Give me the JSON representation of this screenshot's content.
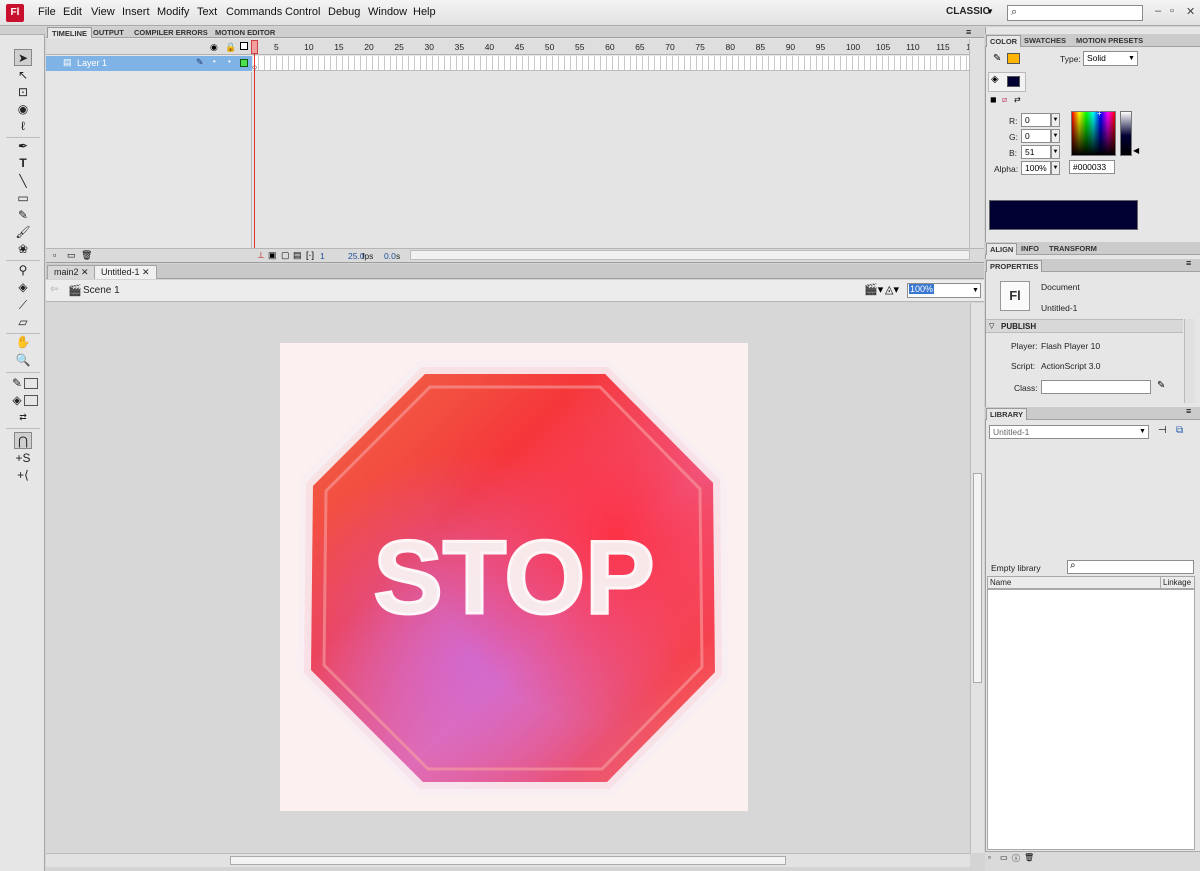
{
  "app": {
    "logo": "Fl",
    "menu": [
      "File",
      "Edit",
      "View",
      "Insert",
      "Modify",
      "Text",
      "Commands",
      "Control",
      "Debug",
      "Window",
      "Help"
    ],
    "workspace": "CLASSIC",
    "search_placeholder": "",
    "window_buttons": [
      "minimize-icon",
      "restore-icon",
      "close-icon"
    ]
  },
  "tools": [
    "selection",
    "subselection",
    "free-transform",
    "3d-rotation",
    "lasso",
    "pen",
    "text",
    "line",
    "rectangle",
    "pencil",
    "brush",
    "deco",
    "bone",
    "paint-bucket",
    "eyedropper",
    "eraser",
    "hand",
    "zoom",
    "stroke-color",
    "fill-color",
    "swap-colors",
    "snap-to-objects",
    "smooth",
    "straighten"
  ],
  "timeline": {
    "tabs": [
      "TIMELINE",
      "OUTPUT",
      "COMPILER ERRORS",
      "MOTION EDITOR"
    ],
    "frame_numbers": [
      "1",
      "5",
      "10",
      "15",
      "20",
      "25",
      "30",
      "35",
      "40",
      "45",
      "50",
      "55",
      "60",
      "65",
      "70",
      "75",
      "80",
      "85",
      "90",
      "95",
      "100",
      "105",
      "110",
      "115",
      "1"
    ],
    "layer_name": "Layer 1",
    "current_frame": "1",
    "fps": "25.0",
    "fps_unit": "fps",
    "elapsed": "0.0",
    "elapsed_unit": "s"
  },
  "documents": {
    "tabs": [
      "main2",
      "Untitled-1"
    ],
    "active": "Untitled-1",
    "scene": "Scene 1",
    "zoom": "100%"
  },
  "stage": {
    "content": "stop-sign-painting",
    "sign_text": "STOP"
  },
  "color_panel": {
    "tabs": [
      "COLOR",
      "SWATCHES",
      "MOTION PRESETS"
    ],
    "type_label": "Type:",
    "type_value": "Solid",
    "r_label": "R:",
    "r_value": "0",
    "g_label": "G:",
    "g_value": "0",
    "b_label": "B:",
    "b_value": "51",
    "alpha_label": "Alpha:",
    "alpha_value": "100%",
    "hex_value": "#000033",
    "stroke_color": "#ffb400",
    "fill_color": "#000033"
  },
  "align_tabs": [
    "ALIGN",
    "INFO",
    "TRANSFORM"
  ],
  "properties": {
    "tab": "PROPERTIES",
    "kind": "Document",
    "doc_icon": "Fl",
    "name": "Untitled-1",
    "publish_header": "PUBLISH",
    "player_label": "Player:",
    "player_value": "Flash Player 10",
    "script_label": "Script:",
    "script_value": "ActionScript 3.0",
    "class_label": "Class:",
    "class_value": ""
  },
  "library": {
    "tab": "LIBRARY",
    "document": "Untitled-1",
    "status": "Empty library",
    "col_name": "Name",
    "col_linkage": "Linkage"
  }
}
